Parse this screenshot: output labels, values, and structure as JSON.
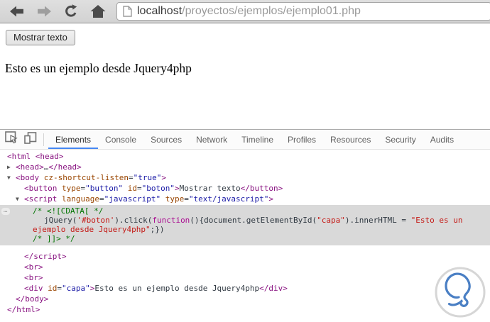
{
  "browser": {
    "url_host": "localhost",
    "url_path": "/proyectos/ejemplos/ejemplo01.php",
    "icons": {
      "back": "arrow-left",
      "forward": "arrow-right-disabled",
      "reload": "circular-arrow",
      "home": "house",
      "url_page": "document-outline"
    }
  },
  "page": {
    "button_label": "Mostrar texto",
    "paragraph": "Esto es un ejemplo desde Jquery4php"
  },
  "devtools": {
    "icons": {
      "inspect": "cursor-in-box",
      "device_toolbar": "phone-and-tablet"
    },
    "tabs": [
      {
        "label": "Elements",
        "active": true
      },
      {
        "label": "Console"
      },
      {
        "label": "Sources"
      },
      {
        "label": "Network"
      },
      {
        "label": "Timeline"
      },
      {
        "label": "Profiles"
      },
      {
        "label": "Resources"
      },
      {
        "label": "Security"
      },
      {
        "label": "Audits"
      }
    ],
    "fold_marker": "…",
    "code": [
      {
        "region": "top",
        "indent": 10,
        "tokens": [
          [
            "tag",
            "<html"
          ],
          [
            "plain",
            " "
          ],
          [
            "tag",
            "<head>"
          ]
        ]
      },
      {
        "region": "top",
        "indent": 22,
        "arrow": "right",
        "tokens": [
          [
            "tag",
            "<head>"
          ],
          [
            "plain",
            "…"
          ],
          [
            "tag",
            "</head>"
          ]
        ]
      },
      {
        "region": "top",
        "indent": 22,
        "arrow": "down",
        "tokens": [
          [
            "tag",
            "<body"
          ],
          [
            "attr",
            " cz-shortcut-listen"
          ],
          [
            "plain",
            "="
          ],
          [
            "val",
            "\"true\""
          ],
          [
            "tag",
            ">"
          ]
        ]
      },
      {
        "region": "top",
        "indent": 34,
        "tokens": [
          [
            "tag",
            "<button"
          ],
          [
            "attr",
            " type"
          ],
          [
            "plain",
            "="
          ],
          [
            "val",
            "\"button\""
          ],
          [
            "attr",
            " id"
          ],
          [
            "plain",
            "="
          ],
          [
            "val",
            "\"boton\""
          ],
          [
            "tag",
            ">"
          ],
          [
            "plain",
            "Mostrar texto"
          ],
          [
            "tag",
            "</button>"
          ]
        ]
      },
      {
        "region": "top",
        "indent": 34,
        "arrow": "down",
        "tokens": [
          [
            "tag",
            "<script"
          ],
          [
            "attr",
            " language"
          ],
          [
            "plain",
            "="
          ],
          [
            "val",
            "\"javascript\""
          ],
          [
            "attr",
            " type"
          ],
          [
            "plain",
            "="
          ],
          [
            "val",
            "\"text/javascript\""
          ],
          [
            "tag",
            ">"
          ]
        ]
      },
      {
        "region": "script",
        "indent": 46,
        "tokens": [
          [
            "comment",
            "/* <![CDATA[ */"
          ]
        ]
      },
      {
        "region": "script",
        "indent": 62,
        "tokens": [
          [
            "plain",
            "jQuery("
          ],
          [
            "string",
            "'#boton'"
          ],
          [
            "plain",
            ").click("
          ],
          [
            "keyword",
            "function"
          ],
          [
            "plain",
            "(){document.getElementById("
          ],
          [
            "string",
            "\"capa\""
          ],
          [
            "plain",
            ").innerHTML = "
          ],
          [
            "string",
            "\"Esto es un"
          ]
        ]
      },
      {
        "region": "script",
        "indent": 46,
        "tokens": [
          [
            "string",
            "ejemplo desde Jquery4php\""
          ],
          [
            "plain",
            ";})"
          ]
        ]
      },
      {
        "region": "script",
        "indent": 46,
        "tokens": [
          [
            "comment",
            "/* ]]> */"
          ]
        ]
      },
      {
        "region": "bottom",
        "indent": 34,
        "tokens": [
          [
            "tag",
            "</script>"
          ]
        ]
      },
      {
        "region": "bottom",
        "indent": 34,
        "tokens": [
          [
            "tag",
            "<br>"
          ]
        ]
      },
      {
        "region": "bottom",
        "indent": 34,
        "tokens": [
          [
            "tag",
            "<br>"
          ]
        ]
      },
      {
        "region": "bottom",
        "indent": 34,
        "tokens": [
          [
            "tag",
            "<div"
          ],
          [
            "attr",
            " id"
          ],
          [
            "plain",
            "="
          ],
          [
            "val",
            "\"capa\""
          ],
          [
            "tag",
            ">"
          ],
          [
            "plain",
            "Esto es un ejemplo desde Jquery4php"
          ],
          [
            "tag",
            "</div>"
          ]
        ]
      },
      {
        "region": "bottom",
        "indent": 22,
        "tokens": [
          [
            "tag",
            "</body>"
          ]
        ]
      },
      {
        "region": "bottom",
        "indent": 10,
        "tokens": [
          [
            "tag",
            "</html>"
          ]
        ]
      }
    ]
  },
  "watermark_icon": "solvetic-speech-bubble-logo",
  "colors": {
    "accent_tab_underline": "#4587f3",
    "toolbar_bg": "#d8d8d8",
    "code_tag": "#881280",
    "code_attr": "#994500",
    "code_attr_value": "#1a1aa6",
    "code_comment": "#007400",
    "code_string": "#c41a16",
    "code_keyword": "#aa0d91",
    "script_block_bg": "#d9d9d9",
    "watermark_blue": "#4a7fc4"
  }
}
